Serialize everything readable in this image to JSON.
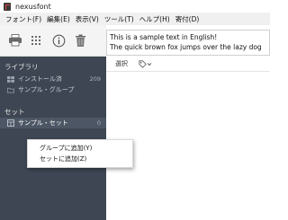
{
  "window": {
    "title": "nexusfont",
    "icon": "app-icon"
  },
  "menu": [
    {
      "label": "フォント(F)"
    },
    {
      "label": "編集(E)"
    },
    {
      "label": "表示(V)"
    },
    {
      "label": "ツール(T)"
    },
    {
      "label": "ヘルプ(H)"
    },
    {
      "label": "寄付(D)"
    }
  ],
  "toolbar": {
    "buttons": [
      {
        "name": "print-icon"
      },
      {
        "name": "grid-icon"
      },
      {
        "name": "info-icon"
      },
      {
        "name": "trash-icon"
      }
    ]
  },
  "sample": {
    "line1": "This is a sample text in English!",
    "line2": "The quick brown fox jumps over the lazy dog"
  },
  "sidebar": {
    "library_header": "ライブラリ",
    "library_items": [
      {
        "label": "インストール済",
        "count": "209",
        "icon": "windows-icon"
      },
      {
        "label": "サンプル・グループ",
        "count": "",
        "icon": "folder-icon"
      }
    ],
    "sets_header": "セット",
    "set_items": [
      {
        "label": "サンプル・セット",
        "count": "0",
        "icon": "set-icon"
      }
    ]
  },
  "main_toolbar": {
    "select_label": "選択",
    "tag_icon": "tag-icon"
  },
  "context_menu": {
    "items": [
      {
        "label": "グループに追加(Y)"
      },
      {
        "label": "セットに追加(Z)"
      }
    ]
  },
  "colors": {
    "sidebar_bg": "#3e4653",
    "selected_bg": "#4c5665",
    "menubar_bg": "#f0f0f0"
  }
}
